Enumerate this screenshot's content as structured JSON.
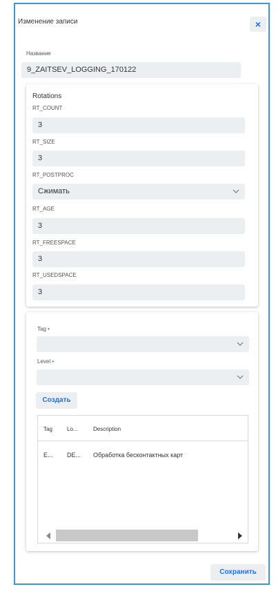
{
  "dialog": {
    "title": "Изменение записи",
    "close_label": "×",
    "save_label": "Сохранить"
  },
  "name_field": {
    "label": "Название",
    "value": "9_ZAITSEV_LOGGING_170122"
  },
  "rotations": {
    "title": "Rotations",
    "fields": [
      {
        "label": "RT_COUNT",
        "value": "3"
      },
      {
        "label": "RT_SIZE",
        "value": "3"
      },
      {
        "label": "RT_POSTPROC",
        "value": "Сжимать"
      },
      {
        "label": "RT_AGE",
        "value": "3"
      },
      {
        "label": "RT_FREESPACE",
        "value": "3"
      },
      {
        "label": "RT_USEDSPACE",
        "value": "3"
      }
    ]
  },
  "tags": {
    "tag_label": "Tag",
    "level_label": "Level",
    "required_marker": "•",
    "tag_value": "",
    "level_value": "",
    "create_label": "Создать",
    "table": {
      "columns": [
        "Tag",
        "Lo...",
        "Description"
      ],
      "rows": [
        [
          "E...",
          "DE...",
          "Обработка бесконтактных карт"
        ]
      ]
    }
  },
  "colors": {
    "accent": "#1a73e8",
    "border": "#3c95d6",
    "field_bg": "#eceff2"
  }
}
